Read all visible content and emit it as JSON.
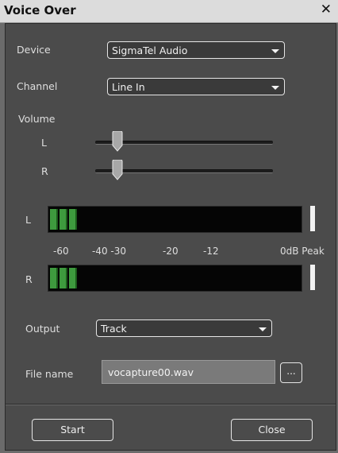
{
  "window": {
    "title": "Voice Over",
    "close_glyph": "✕"
  },
  "device": {
    "label": "Device",
    "value": "SigmaTel Audio"
  },
  "channel": {
    "label": "Channel",
    "value": "Line In"
  },
  "volume": {
    "label": "Volume",
    "left_label": "L",
    "right_label": "R",
    "left_level": 0.09,
    "right_level": 0.09
  },
  "meter": {
    "left_label": "L",
    "right_label": "R",
    "scale": [
      "-60",
      "-40 -30",
      "-20",
      "-12",
      "0dB Peak"
    ],
    "left_lit_segments": 3,
    "right_lit_segments": 3
  },
  "output": {
    "label": "Output",
    "value": "Track"
  },
  "file": {
    "label": "File name",
    "value": "vocapture00.wav",
    "browse_label": "..."
  },
  "buttons": {
    "start": "Start",
    "close": "Close"
  },
  "colors": {
    "meter_green": "#3e9a3e",
    "panel_bg": "#4b4b4b",
    "titlebar_bg": "#dcdcdc"
  },
  "icons": {
    "close": "close-icon",
    "dropdown": "chevron-down-icon"
  }
}
